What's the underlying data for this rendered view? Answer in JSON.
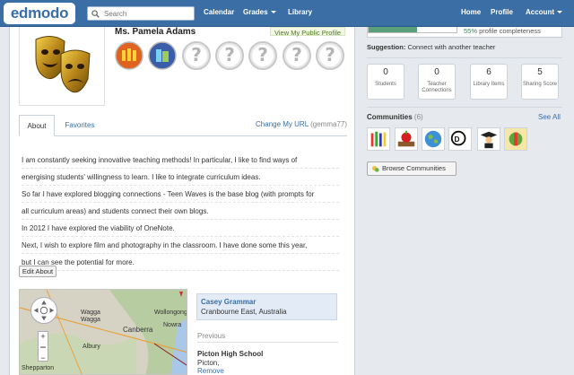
{
  "nav": {
    "logo": "edmodo",
    "search_placeholder": "Search",
    "links": [
      "Calendar",
      "Grades",
      "Library"
    ],
    "right_links": [
      "Home",
      "Profile",
      "Account"
    ]
  },
  "profile": {
    "name": "Ms. Pamela Adams",
    "view_public": "View My Public Profile",
    "badge_empty_glyph": "?"
  },
  "tabs": {
    "about": "About",
    "favorites": "Favorites"
  },
  "change_url": {
    "label": "Change My URL",
    "username": "(gemma77)"
  },
  "about_lines": [
    "I am constantly seeking innovative teaching methods! In particular, I like to find ways of",
    "energising students' willingness to learn. I like to integrate curriculum ideas.",
    "So far I have explored blogging connections - Teen Waves is the base blog (with prompts for",
    "all curriculum areas) and students connect their own blogs.",
    "In 2012 I have explored the viability of OneNote.",
    "Next, I wish to explore film and photography in the classroom. I have done some this year,",
    "but I can see the potential for more."
  ],
  "edit_about": "Edit About",
  "map": {
    "labels": [
      "Wagga",
      "Wagga",
      "Canberra",
      "Wollongong",
      "Nowra",
      "Albury",
      "Shepparton"
    ]
  },
  "school": {
    "current_name": "Casey Grammar",
    "current_location": "Cranbourne East, Australia",
    "previous_label": "Previous",
    "previous_name": "Picton High School",
    "previous_location": "Picton,",
    "remove": "Remove"
  },
  "completeness": {
    "percent_text": "55%",
    "suffix": "profile completeness",
    "value": 0.55
  },
  "suggestion": {
    "label": "Suggestion:",
    "text": "Connect with another teacher"
  },
  "stats": [
    {
      "value": "0",
      "label": "Students"
    },
    {
      "value": "0",
      "label": "Teacher Connections"
    },
    {
      "value": "6",
      "label": "Library Items"
    },
    {
      "value": "5",
      "label": "Sharing Score"
    }
  ],
  "communities": {
    "label": "Communities",
    "count": "(6)",
    "see_all": "See All",
    "browse": "Browse Communities"
  },
  "colors": {
    "nav": "#3a6ea5",
    "link": "#3a6ea5",
    "progress": "#5aa07a"
  }
}
